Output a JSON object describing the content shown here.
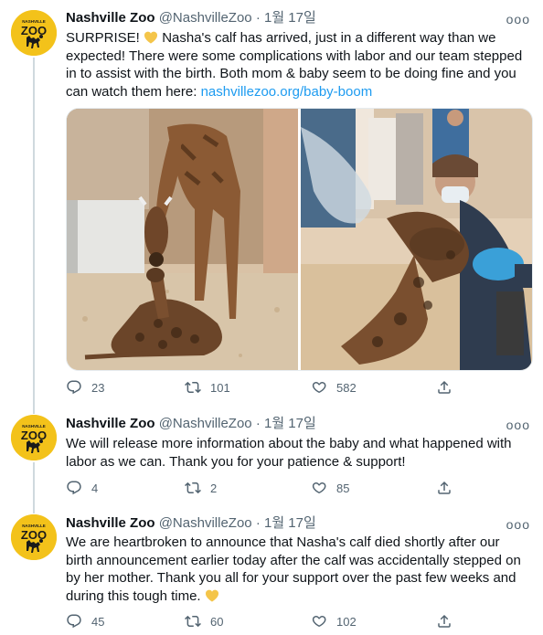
{
  "colors": {
    "text": "#0f1419",
    "secondary": "#536471",
    "link": "#1d9bf0",
    "avatar_bg": "#f3c21a",
    "heart_emoji": "#f4c54a"
  },
  "avatar_logo_text": "ZOO",
  "avatar_logo_small": "NASHVILLE",
  "tweets": [
    {
      "name": "Nashville Zoo",
      "handle": "@NashvilleZoo",
      "sep": "·",
      "date": "1월 17일",
      "more": "ooo",
      "text_lines": [
        "SURPRISE! ",
        " Nasha's calf has arrived, just in a different way than we",
        "expected! There were some complications with labor and our team stepped",
        "in to assist with the birth. Both mom & baby seem to be doing fine and you",
        "can watch them here: "
      ],
      "link": "nashvillezoo.org/baby-boom",
      "replies": "23",
      "retweets": "101",
      "likes": "582"
    },
    {
      "name": "Nashville Zoo",
      "handle": "@NashvilleZoo",
      "sep": "·",
      "date": "1월 17일",
      "more": "ooo",
      "text_lines": [
        "We will release more information about the baby and what happened with",
        "labor as we can. Thank you for your patience & support!"
      ],
      "replies": "4",
      "retweets": "2",
      "likes": "85"
    },
    {
      "name": "Nashville Zoo",
      "handle": "@NashvilleZoo",
      "sep": "·",
      "date": "1월 17일",
      "more": "ooo",
      "text_lines": [
        "We are heartbroken to announce that Nasha's calf died shortly after our",
        "birth announcement earlier today after the calf was accidentally stepped on",
        "by her mother. Thank you all for your support over the past few weeks and",
        "during this tough time. "
      ],
      "replies": "45",
      "retweets": "60",
      "likes": "102"
    }
  ]
}
